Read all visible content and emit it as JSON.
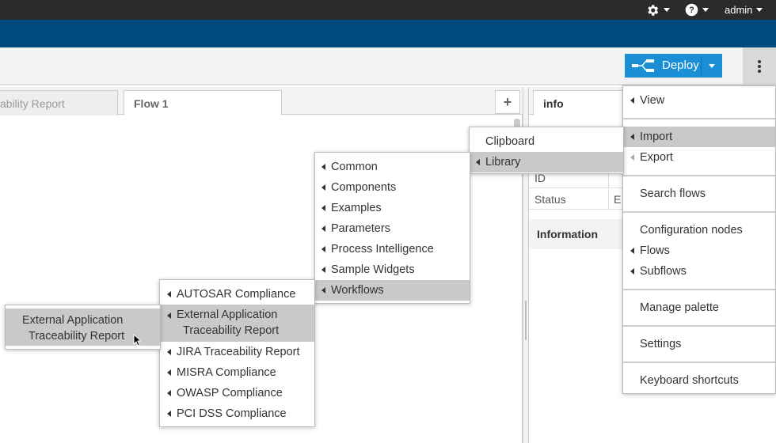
{
  "header": {
    "settings_icon": "gear-icon",
    "help_icon": "question-circle-icon",
    "user_label": "admin"
  },
  "toolbar": {
    "deploy_label": "Deploy",
    "deploy_icon": "deploy-flow-icon"
  },
  "workspace": {
    "tabs": [
      {
        "label": "ability Report"
      },
      {
        "label": "Flow 1"
      }
    ],
    "add_tab_label": "+"
  },
  "sidebar": {
    "tab_label": "info",
    "rows": [
      {
        "label": "ID",
        "value": ""
      },
      {
        "label": "Status",
        "value": "E"
      }
    ],
    "section_label": "Information"
  },
  "main_menu": {
    "items": [
      {
        "label": "View"
      },
      {
        "label": "Import"
      },
      {
        "label": "Export"
      },
      {
        "label": "Search flows"
      },
      {
        "label": "Configuration nodes"
      },
      {
        "label": "Flows"
      },
      {
        "label": "Subflows"
      },
      {
        "label": "Manage palette"
      },
      {
        "label": "Settings"
      },
      {
        "label": "Keyboard shortcuts"
      }
    ]
  },
  "import_menu": {
    "items": [
      {
        "label": "Clipboard"
      },
      {
        "label": "Library"
      }
    ]
  },
  "library_menu": {
    "items": [
      {
        "label": "Common"
      },
      {
        "label": "Components"
      },
      {
        "label": "Examples"
      },
      {
        "label": "Parameters"
      },
      {
        "label": "Process Intelligence"
      },
      {
        "label": "Sample Widgets"
      },
      {
        "label": "Workflows"
      }
    ]
  },
  "workflows_menu": {
    "items": [
      {
        "label": "AUTOSAR Compliance"
      },
      {
        "label": "External Application"
      },
      {
        "label": "Traceability Report"
      },
      {
        "label": "JIRA Traceability Report"
      },
      {
        "label": "MISRA Compliance"
      },
      {
        "label": "OWASP Compliance"
      },
      {
        "label": "PCI DSS Compliance"
      }
    ]
  },
  "leaf_menu": {
    "line1": "External Application",
    "line2": "Traceability Report"
  }
}
